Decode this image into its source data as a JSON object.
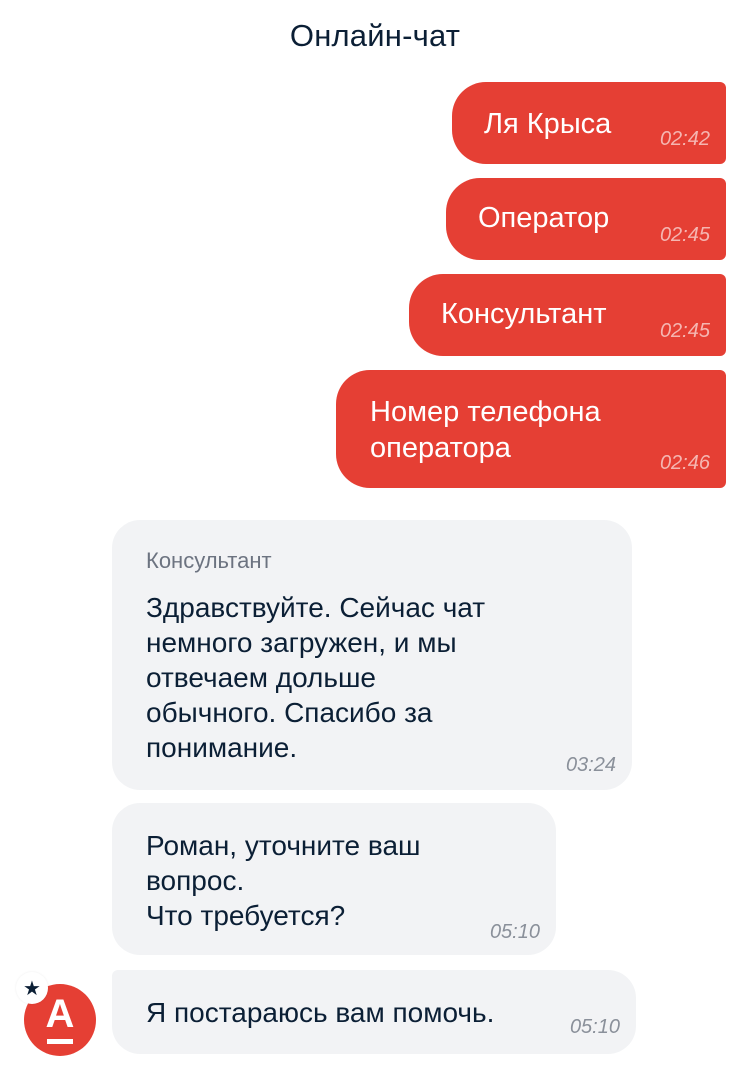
{
  "header": {
    "title": "Онлайн-чат"
  },
  "colors": {
    "outgoing_bubble": "#e53f34",
    "incoming_bubble": "#f2f3f5",
    "text_dark": "#0b1f35"
  },
  "messages": [
    {
      "direction": "outgoing",
      "text": "Ля Крыса",
      "time": "02:42"
    },
    {
      "direction": "outgoing",
      "text": "Оператор",
      "time": "02:45"
    },
    {
      "direction": "outgoing",
      "text": "Консультант",
      "time": "02:45"
    },
    {
      "direction": "outgoing",
      "text": "Номер телефона\nоператора",
      "time": "02:46"
    },
    {
      "direction": "incoming",
      "sender": "Консультант",
      "text": "Здравствуйте. Сейчас чат\nнемного загружен, и мы\nотвечаем дольше\nобычного. Спасибо за\nпонимание.",
      "time": "03:24"
    },
    {
      "direction": "incoming",
      "text": "Роман, уточните ваш\nвопрос.\nЧто требуется?",
      "time": "05:10"
    },
    {
      "direction": "incoming",
      "text": "Я постараюсь вам помочь.",
      "time": "05:10"
    }
  ],
  "avatar": {
    "letter": "А",
    "badge_icon": "star-icon",
    "badge_glyph": "★"
  }
}
